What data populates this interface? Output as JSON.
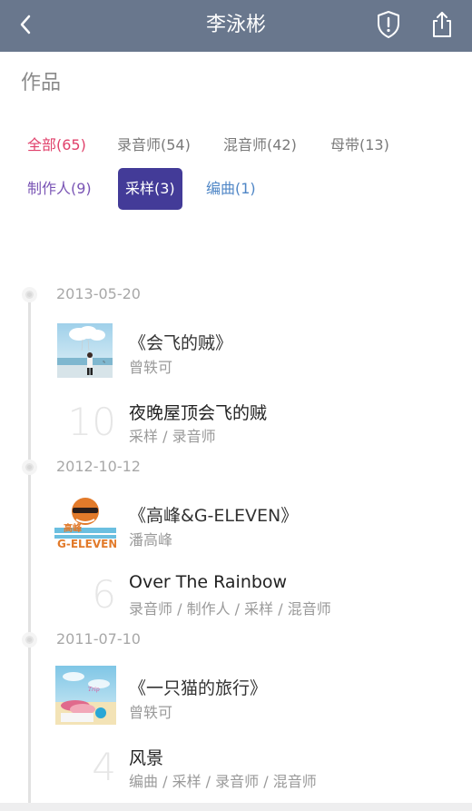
{
  "header": {
    "title": "李泳彬",
    "back_icon": "chevron-left-icon",
    "report_icon": "shield-alert-icon",
    "share_icon": "share-icon",
    "bg_color": "#69778d"
  },
  "section": {
    "title": "作品"
  },
  "filters": [
    {
      "label": "全部(65)",
      "color": "#e0416b"
    },
    {
      "label": "录音师(54)",
      "color": "#7a7a7a"
    },
    {
      "label": "混音师(42)",
      "color": "#7a7a7a"
    },
    {
      "label": "母带(13)",
      "color": "#7a7a7a"
    },
    {
      "label": "制作人(9)",
      "color": "#7a55b5"
    },
    {
      "label": "采样(3)",
      "color": "#ffffff",
      "selected": true,
      "bg": "#433b98"
    },
    {
      "label": "编曲(1)",
      "color": "#4f86c6"
    }
  ],
  "timeline": [
    {
      "date": "2013-05-20",
      "album": {
        "title": "《会飞的贼》",
        "artist": "曾轶可"
      },
      "track": {
        "number": "10",
        "title": "夜晚屋顶会飞的贼",
        "roles": "采样 / 录音师"
      }
    },
    {
      "date": "2012-10-12",
      "album": {
        "title": "《高峰&G-ELEVEN》",
        "artist": "潘高峰"
      },
      "track": {
        "number": "6",
        "title": "Over The Rainbow",
        "roles": "录音师 / 制作人 / 采样 / 混音师"
      }
    },
    {
      "date": "2011-07-10",
      "album": {
        "title": "《一只猫的旅行》",
        "artist": "曾轶可"
      },
      "track": {
        "number": "4",
        "title": "风景",
        "roles": "编曲 / 采样 / 录音师 / 混音师"
      }
    }
  ]
}
